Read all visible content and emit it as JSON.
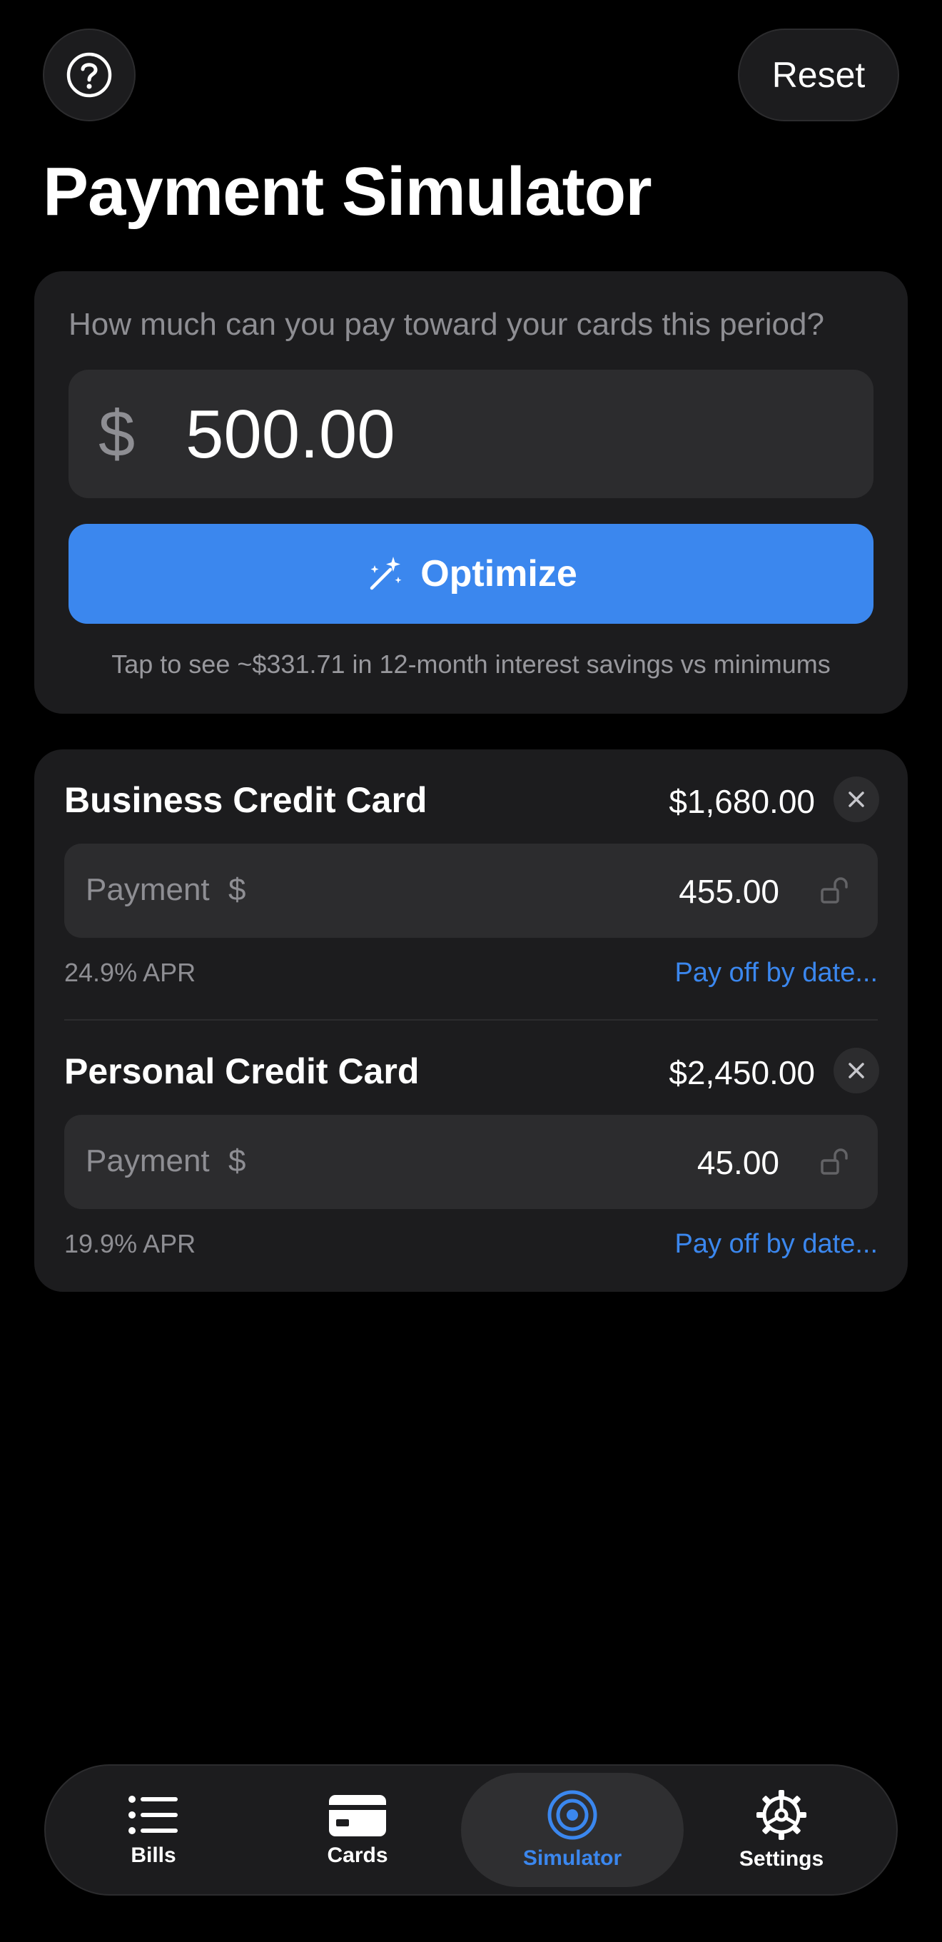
{
  "header": {
    "help_icon": "question-circle-icon",
    "reset_label": "Reset",
    "title": "Payment Simulator"
  },
  "budget": {
    "question": "How much can you pay toward your cards this period?",
    "currency_symbol": "$",
    "amount": "500.00",
    "optimize_icon": "magic-wand-icon",
    "optimize_label": "Optimize",
    "savings_note": "Tap to see ~$331.71 in 12-month interest savings vs minimums"
  },
  "cards": [
    {
      "name": "Business Credit Card",
      "balance": "$1,680.00",
      "payment_label": "Payment",
      "payment_currency": "$",
      "payment": "455.00",
      "apr": "24.9% APR",
      "payoff_link": "Pay off by date..."
    },
    {
      "name": "Personal Credit Card",
      "balance": "$2,450.00",
      "payment_label": "Payment",
      "payment_currency": "$",
      "payment": "45.00",
      "apr": "19.9% APR",
      "payoff_link": "Pay off by date..."
    }
  ],
  "tabbar": {
    "tabs": [
      {
        "label": "Bills",
        "icon": "list-icon"
      },
      {
        "label": "Cards",
        "icon": "credit-card-icon"
      },
      {
        "label": "Simulator",
        "icon": "target-icon",
        "active": true
      },
      {
        "label": "Settings",
        "icon": "gear-icon"
      }
    ]
  },
  "colors": {
    "background": "#000000",
    "surface": "#1c1c1e",
    "field": "#2c2c2e",
    "accent": "#3b87ee",
    "secondary_text": "#8e8e93"
  }
}
